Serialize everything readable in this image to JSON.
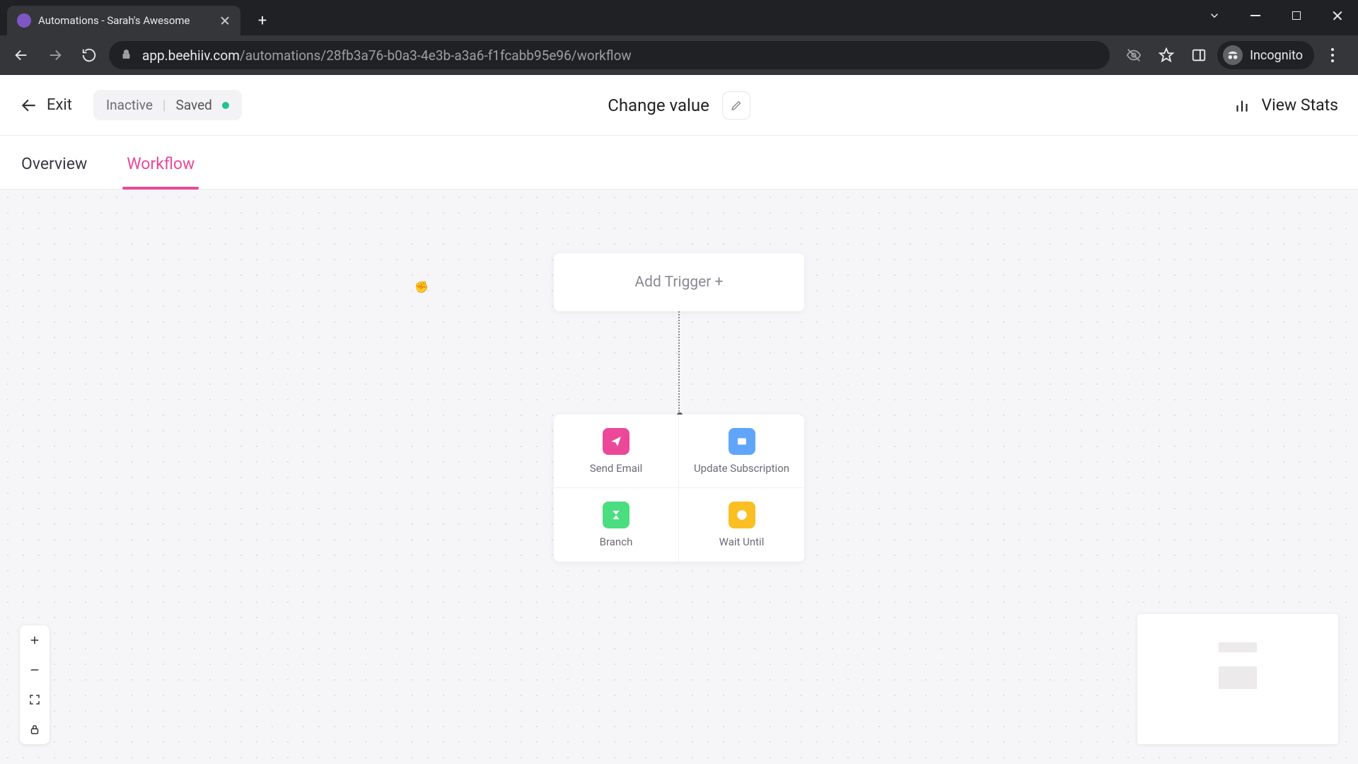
{
  "browser": {
    "tab_title": "Automations - Sarah's Awesome",
    "url_host": "app.beehiiv.com",
    "url_path": "/automations/28fb3a76-b0a3-4e3b-a3a6-f1fcabb95e96/workflow",
    "incognito_label": "Incognito"
  },
  "header": {
    "exit_label": "Exit",
    "status_inactive": "Inactive",
    "status_saved": "Saved",
    "automation_name": "Change value",
    "view_stats_label": "View Stats"
  },
  "subnav": {
    "overview": "Overview",
    "workflow": "Workflow",
    "active_tab": "workflow"
  },
  "canvas": {
    "trigger_label": "Add Trigger +",
    "actions": [
      {
        "id": "send-email",
        "label": "Send Email",
        "color": "pink",
        "icon": "paper-plane"
      },
      {
        "id": "update-subscription",
        "label": "Update Subscription",
        "color": "blue",
        "icon": "card"
      },
      {
        "id": "branch",
        "label": "Branch",
        "color": "green",
        "icon": "branch"
      },
      {
        "id": "wait-until",
        "label": "Wait Until",
        "color": "yellow",
        "icon": "clock"
      }
    ]
  }
}
